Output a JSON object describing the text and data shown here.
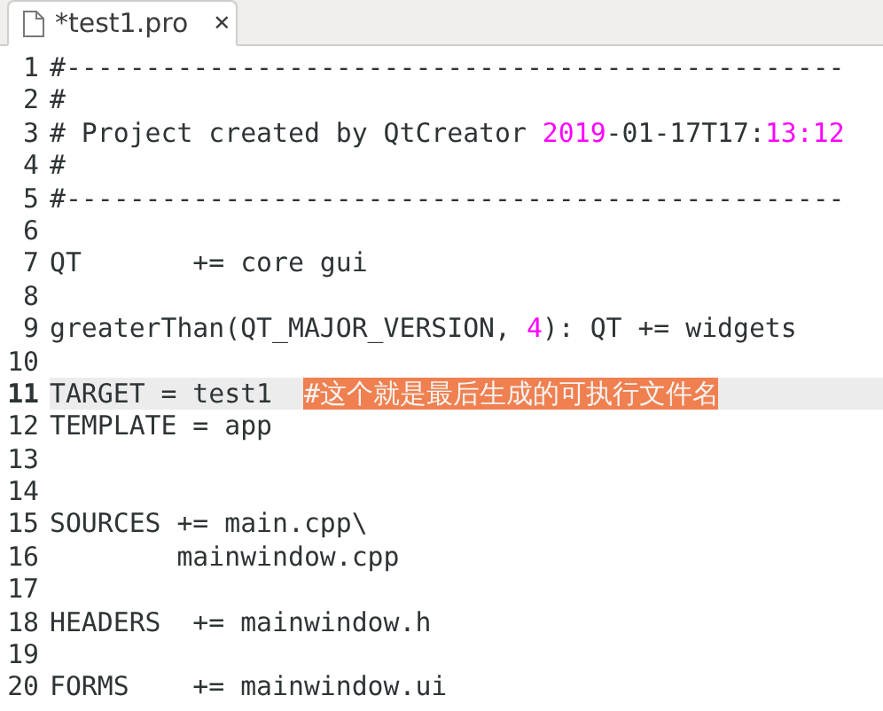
{
  "tab": {
    "title": "*test1.pro",
    "close": "✕",
    "selected": true
  },
  "lines": [
    {
      "number": "1",
      "current": false,
      "segments": [
        {
          "kind": "plain",
          "text": "#-------------------------------------------------"
        }
      ]
    },
    {
      "number": "2",
      "current": false,
      "segments": [
        {
          "kind": "plain",
          "text": "#"
        }
      ]
    },
    {
      "number": "3",
      "current": false,
      "segments": [
        {
          "kind": "plain",
          "text": "# Project created by QtCreator "
        },
        {
          "kind": "number",
          "text": "2019"
        },
        {
          "kind": "plain",
          "text": "-01-17T17:"
        },
        {
          "kind": "number",
          "text": "13:12"
        }
      ]
    },
    {
      "number": "4",
      "current": false,
      "segments": [
        {
          "kind": "plain",
          "text": "#"
        }
      ]
    },
    {
      "number": "5",
      "current": false,
      "segments": [
        {
          "kind": "plain",
          "text": "#-------------------------------------------------"
        }
      ]
    },
    {
      "number": "6",
      "current": false
    },
    {
      "number": "7",
      "current": false,
      "segments": [
        {
          "kind": "plain",
          "text": "QT       += core gui"
        }
      ]
    },
    {
      "number": "8",
      "current": false
    },
    {
      "number": "9",
      "current": false,
      "segments": [
        {
          "kind": "plain",
          "text": "greaterThan(QT_MAJOR_VERSION, "
        },
        {
          "kind": "number",
          "text": "4"
        },
        {
          "kind": "plain",
          "text": "): QT += widgets"
        }
      ]
    },
    {
      "number": "10",
      "current": false
    },
    {
      "number": "11",
      "current": true,
      "segments": [
        {
          "kind": "plain",
          "text": "TARGET = test1  "
        },
        {
          "kind": "highlight",
          "text": "#这个就是最后生成的可执行文件名"
        }
      ]
    },
    {
      "number": "12",
      "current": false,
      "segments": [
        {
          "kind": "plain",
          "text": "TEMPLATE = app"
        }
      ]
    },
    {
      "number": "13",
      "current": false
    },
    {
      "number": "14",
      "current": false
    },
    {
      "number": "15",
      "current": false,
      "segments": [
        {
          "kind": "plain",
          "text": "SOURCES += main.cpp\\"
        }
      ]
    },
    {
      "number": "16",
      "current": false,
      "segments": [
        {
          "kind": "plain",
          "text": "        mainwindow.cpp"
        }
      ]
    },
    {
      "number": "17",
      "current": false
    },
    {
      "number": "18",
      "current": false,
      "segments": [
        {
          "kind": "plain",
          "text": "HEADERS  += mainwindow.h"
        }
      ]
    },
    {
      "number": "19",
      "current": false
    },
    {
      "number": "20",
      "current": false,
      "segments": [
        {
          "kind": "plain",
          "text": "FORMS    += mainwindow.ui"
        }
      ]
    }
  ]
}
